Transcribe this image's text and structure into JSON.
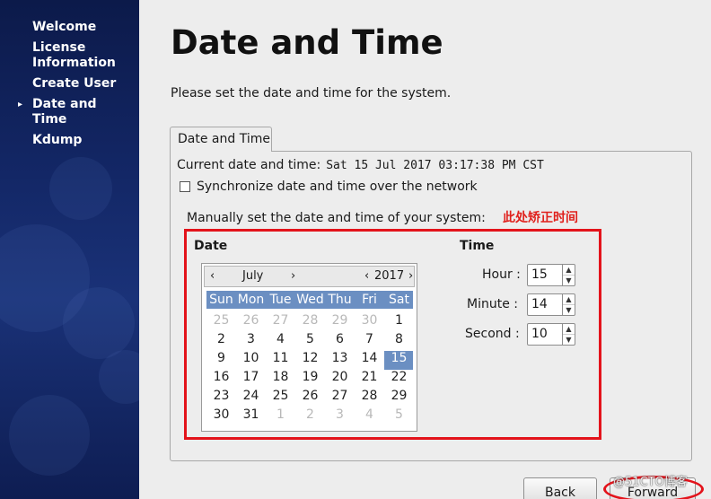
{
  "sidebar": {
    "steps": [
      {
        "label": "Welcome",
        "current": false
      },
      {
        "label": "License Information",
        "current": false
      },
      {
        "label": "Create User",
        "current": false
      },
      {
        "label": "Date and Time",
        "current": true
      },
      {
        "label": "Kdump",
        "current": false
      }
    ]
  },
  "page": {
    "title": "Date and Time",
    "intro": "Please set the date and time for the system."
  },
  "tab": {
    "label": "Date and Time"
  },
  "current": {
    "label": "Current date and time:",
    "value": "Sat 15 Jul 2017 03:17:38 PM CST"
  },
  "sync": {
    "label": "Synchronize date and time over the network",
    "checked": false
  },
  "manual": {
    "label": "Manually set the date and time of your system:"
  },
  "annotation": {
    "text": "此处矫正时间",
    "color": "#e3131b"
  },
  "date_section": {
    "label": "Date"
  },
  "time_section": {
    "label": "Time"
  },
  "calendar": {
    "month": "July",
    "year": "2017",
    "prev_month": "‹",
    "next_month": "›",
    "prev_year": "‹",
    "next_year": "›",
    "weekdays": [
      "Sun",
      "Mon",
      "Tue",
      "Wed",
      "Thu",
      "Fri",
      "Sat"
    ],
    "weeks": [
      [
        "25",
        "26",
        "27",
        "28",
        "29",
        "30",
        "1"
      ],
      [
        "2",
        "3",
        "4",
        "5",
        "6",
        "7",
        "8"
      ],
      [
        "9",
        "10",
        "11",
        "12",
        "13",
        "14",
        "15"
      ],
      [
        "16",
        "17",
        "18",
        "19",
        "20",
        "21",
        "22"
      ],
      [
        "23",
        "24",
        "25",
        "26",
        "27",
        "28",
        "29"
      ],
      [
        "30",
        "31",
        "1",
        "2",
        "3",
        "4",
        "5"
      ]
    ],
    "selected_day": "15",
    "header_color": "#6b8fc2"
  },
  "time": {
    "hour_label": "Hour :",
    "hour": "15",
    "minute_label": "Minute :",
    "minute": "14",
    "second_label": "Second :",
    "second": "10"
  },
  "buttons": {
    "back": "Back",
    "forward": "Forward"
  },
  "watermark": "@51CTO博客",
  "icons": {
    "current_step": "triangle-right-icon",
    "spin_up": "chevron-up-icon",
    "spin_down": "chevron-down-icon"
  }
}
